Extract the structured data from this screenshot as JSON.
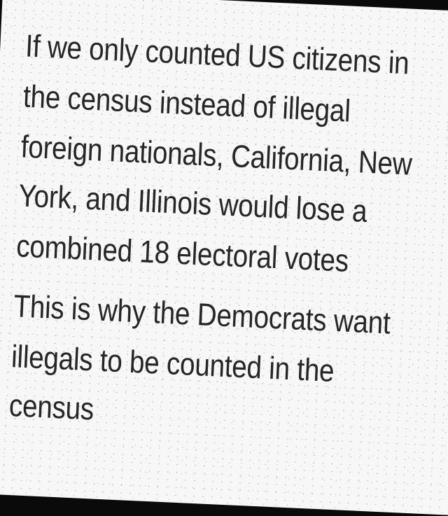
{
  "post": {
    "paragraph1": [
      "If we only counted US citizens in",
      "the census instead of illegal",
      "foreign nationals, California, New",
      "York, and Illinois would lose a",
      "combined 18 electoral votes"
    ],
    "paragraph2": [
      "This is why the Democrats want",
      "illegals to be counted in the",
      "census"
    ]
  }
}
